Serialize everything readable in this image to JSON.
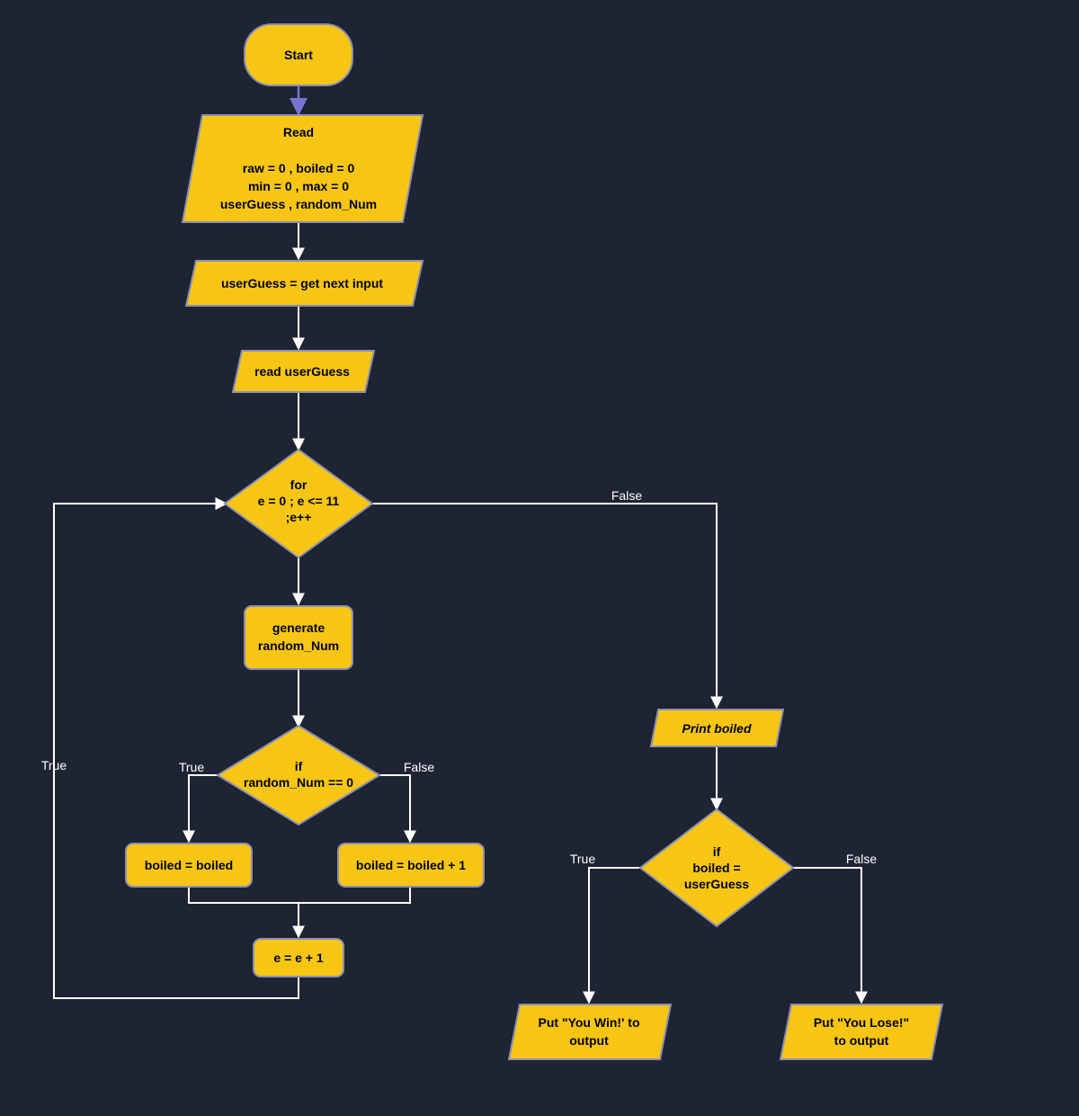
{
  "nodes": {
    "start": {
      "label": "Start"
    },
    "read": {
      "title": "Read",
      "line1": "raw = 0 , boiled = 0",
      "line2": "min = 0 , max = 0",
      "line3": "userGuess , random_Num"
    },
    "getinput": {
      "label": "userGuess = get next input"
    },
    "readguess": {
      "label": "read userGuess"
    },
    "for": {
      "line1": "for",
      "line2": "e = 0 ; e <= 11",
      "line3": ";e++"
    },
    "generate": {
      "line1": "generate",
      "line2": "random_Num"
    },
    "ifrand": {
      "line1": "if",
      "line2": "random_Num == 0"
    },
    "boiledsame": {
      "label": "boiled = boiled"
    },
    "boiledinc": {
      "label": "boiled = boiled + 1"
    },
    "eincr": {
      "label": "e = e + 1"
    },
    "printboiled": {
      "label": "Print boiled"
    },
    "ifguess": {
      "line1": "if",
      "line2": "boiled =",
      "line3": "userGuess"
    },
    "win": {
      "line1": "Put \"You Win!' to",
      "line2": "output"
    },
    "lose": {
      "line1": "Put \"You Lose!\"",
      "line2": "to output"
    }
  },
  "edges": {
    "true": "True",
    "false": "False"
  },
  "colors": {
    "fill": "#f7c615",
    "stroke": "#8a8fb5",
    "bg": "#1f2433",
    "arrow": "#ffffff"
  }
}
